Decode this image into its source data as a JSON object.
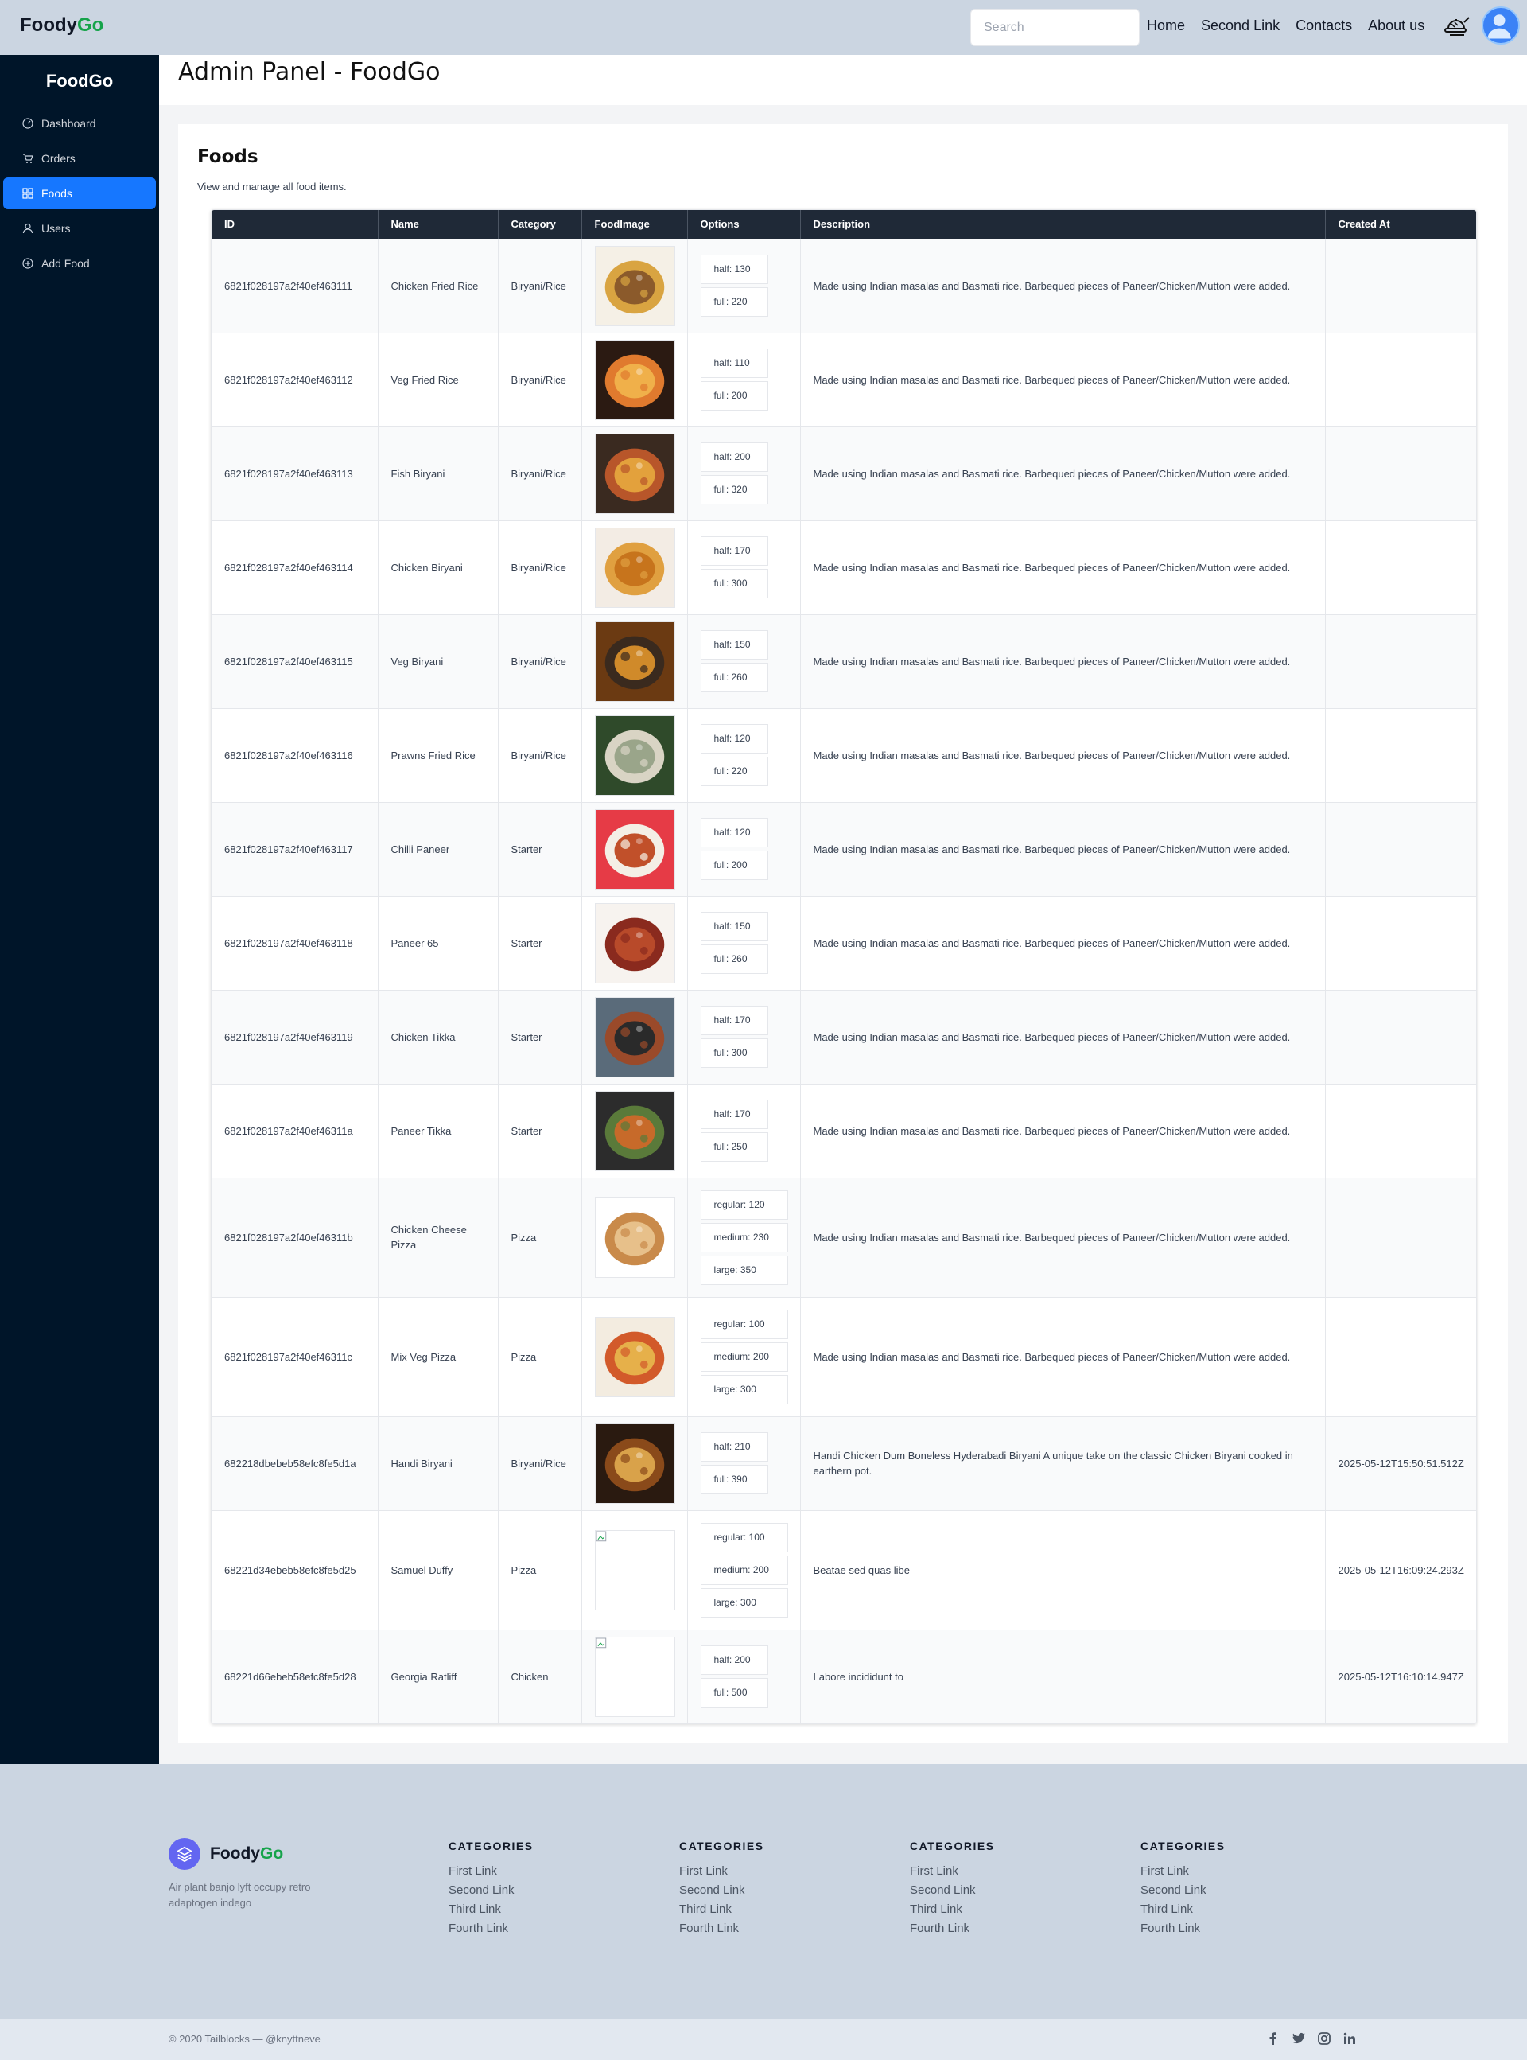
{
  "navbar": {
    "logo_main": "Foody",
    "logo_accent": "Go",
    "search_placeholder": "Search",
    "links": [
      "Home",
      "Second Link",
      "Contacts",
      "About us"
    ]
  },
  "sidebar": {
    "brand": "FoodGo",
    "items": [
      {
        "label": "Dashboard",
        "icon": "dashboard-icon"
      },
      {
        "label": "Orders",
        "icon": "cart-icon"
      },
      {
        "label": "Foods",
        "icon": "grid-icon",
        "active": true
      },
      {
        "label": "Users",
        "icon": "user-icon"
      },
      {
        "label": "Add Food",
        "icon": "plus-circle-icon"
      }
    ]
  },
  "page": {
    "title": "Admin Panel - FoodGo"
  },
  "foods": {
    "title": "Foods",
    "subtitle": "View and manage all food items.",
    "columns": [
      "ID",
      "Name",
      "Category",
      "FoodImage",
      "Options",
      "Description",
      "Created At"
    ],
    "rows": [
      {
        "id": "6821f028197a2f40ef463111",
        "name": "Chicken Fried Rice",
        "category": "Biryani/Rice",
        "image": "fried-rice",
        "options": [
          "half: 130",
          "full: 220"
        ],
        "description": "Made using Indian masalas and Basmati rice. Barbequed pieces of Paneer/Chicken/Mutton were added.",
        "created_at": ""
      },
      {
        "id": "6821f028197a2f40ef463112",
        "name": "Veg Fried Rice",
        "category": "Biryani/Rice",
        "image": "veg-rice",
        "options": [
          "half: 110",
          "full: 200"
        ],
        "description": "Made using Indian masalas and Basmati rice. Barbequed pieces of Paneer/Chicken/Mutton were added.",
        "created_at": ""
      },
      {
        "id": "6821f028197a2f40ef463113",
        "name": "Fish Biryani",
        "category": "Biryani/Rice",
        "image": "fish-biryani",
        "options": [
          "half: 200",
          "full: 320"
        ],
        "description": "Made using Indian masalas and Basmati rice. Barbequed pieces of Paneer/Chicken/Mutton were added.",
        "created_at": ""
      },
      {
        "id": "6821f028197a2f40ef463114",
        "name": "Chicken Biryani",
        "category": "Biryani/Rice",
        "image": "chicken-biryani",
        "options": [
          "half: 170",
          "full: 300"
        ],
        "description": "Made using Indian masalas and Basmati rice. Barbequed pieces of Paneer/Chicken/Mutton were added.",
        "created_at": ""
      },
      {
        "id": "6821f028197a2f40ef463115",
        "name": "Veg Biryani",
        "category": "Biryani/Rice",
        "image": "veg-biryani",
        "options": [
          "half: 150",
          "full: 260"
        ],
        "description": "Made using Indian masalas and Basmati rice. Barbequed pieces of Paneer/Chicken/Mutton were added.",
        "created_at": ""
      },
      {
        "id": "6821f028197a2f40ef463116",
        "name": "Prawns Fried Rice",
        "category": "Biryani/Rice",
        "image": "prawns-rice",
        "options": [
          "half: 120",
          "full: 220"
        ],
        "description": "Made using Indian masalas and Basmati rice. Barbequed pieces of Paneer/Chicken/Mutton were added.",
        "created_at": ""
      },
      {
        "id": "6821f028197a2f40ef463117",
        "name": "Chilli Paneer",
        "category": "Starter",
        "image": "chilli-paneer",
        "options": [
          "half: 120",
          "full: 200"
        ],
        "description": "Made using Indian masalas and Basmati rice. Barbequed pieces of Paneer/Chicken/Mutton were added.",
        "created_at": ""
      },
      {
        "id": "6821f028197a2f40ef463118",
        "name": "Paneer 65",
        "category": "Starter",
        "image": "paneer-65",
        "options": [
          "half: 150",
          "full: 260"
        ],
        "description": "Made using Indian masalas and Basmati rice. Barbequed pieces of Paneer/Chicken/Mutton were added.",
        "created_at": ""
      },
      {
        "id": "6821f028197a2f40ef463119",
        "name": "Chicken Tikka",
        "category": "Starter",
        "image": "chicken-tikka",
        "options": [
          "half: 170",
          "full: 300"
        ],
        "description": "Made using Indian masalas and Basmati rice. Barbequed pieces of Paneer/Chicken/Mutton were added.",
        "created_at": ""
      },
      {
        "id": "6821f028197a2f40ef46311a",
        "name": "Paneer Tikka",
        "category": "Starter",
        "image": "paneer-tikka",
        "options": [
          "half: 170",
          "full: 250"
        ],
        "description": "Made using Indian masalas and Basmati rice. Barbequed pieces of Paneer/Chicken/Mutton were added.",
        "created_at": ""
      },
      {
        "id": "6821f028197a2f40ef46311b",
        "name": "Chicken Cheese Pizza",
        "category": "Pizza",
        "image": "cheese-pizza",
        "options": [
          "regular: 120",
          "medium: 230",
          "large: 350"
        ],
        "description": "Made using Indian masalas and Basmati rice. Barbequed pieces of Paneer/Chicken/Mutton were added.",
        "created_at": ""
      },
      {
        "id": "6821f028197a2f40ef46311c",
        "name": "Mix Veg Pizza",
        "category": "Pizza",
        "image": "veg-pizza",
        "options": [
          "regular: 100",
          "medium: 200",
          "large: 300"
        ],
        "description": "Made using Indian masalas and Basmati rice. Barbequed pieces of Paneer/Chicken/Mutton were added.",
        "created_at": ""
      },
      {
        "id": "682218dbebeb58efc8fe5d1a",
        "name": "Handi Biryani",
        "category": "Biryani/Rice",
        "image": "handi-biryani",
        "options": [
          "half: 210",
          "full: 390"
        ],
        "description": "Handi Chicken Dum Boneless Hyderabadi Biryani A unique take on the classic Chicken Biryani cooked in earthern pot.",
        "created_at": "2025-05-12T15:50:51.512Z"
      },
      {
        "id": "68221d34ebeb58efc8fe5d25",
        "name": "Samuel Duffy",
        "category": "Pizza",
        "image": "broken-image",
        "options": [
          "regular: 100",
          "medium: 200",
          "large: 300"
        ],
        "description": "Beatae sed quas libe",
        "created_at": "2025-05-12T16:09:24.293Z"
      },
      {
        "id": "68221d66ebeb58efc8fe5d28",
        "name": "Georgia Ratliff",
        "category": "Chicken",
        "image": "broken-image",
        "options": [
          "half: 200",
          "full: 500"
        ],
        "description": "Labore incididunt to",
        "created_at": "2025-05-12T16:10:14.947Z"
      }
    ]
  },
  "footer": {
    "brand_main": "Foody",
    "brand_accent": "Go",
    "tagline": "Air plant banjo lyft occupy retro adaptogen indego",
    "columns": [
      {
        "title": "CATEGORIES",
        "links": [
          "First Link",
          "Second Link",
          "Third Link",
          "Fourth Link"
        ]
      },
      {
        "title": "CATEGORIES",
        "links": [
          "First Link",
          "Second Link",
          "Third Link",
          "Fourth Link"
        ]
      },
      {
        "title": "CATEGORIES",
        "links": [
          "First Link",
          "Second Link",
          "Third Link",
          "Fourth Link"
        ]
      },
      {
        "title": "CATEGORIES",
        "links": [
          "First Link",
          "Second Link",
          "Third Link",
          "Fourth Link"
        ]
      }
    ],
    "copyright": "© 2020 Tailblocks — @knyttneve",
    "social_icons": [
      "facebook-icon",
      "twitter-icon",
      "instagram-icon",
      "linkedin-icon"
    ]
  },
  "colors": {
    "accent": "#1677ff",
    "sidebar_bg": "#001529",
    "header_bg": "#cbd5e1",
    "brand_green": "#16a34a",
    "table_header": "#1f2937"
  }
}
